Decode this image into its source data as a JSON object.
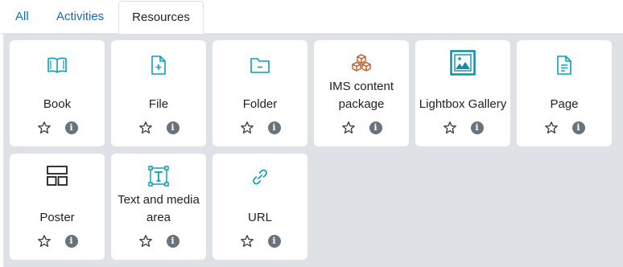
{
  "tabs": [
    {
      "label": "All",
      "active": false
    },
    {
      "label": "Activities",
      "active": false
    },
    {
      "label": "Resources",
      "active": true
    }
  ],
  "colors": {
    "teal": "#0d9eb7",
    "orange": "#c05a25",
    "dark": "#1d2125",
    "link": "#0f6cbf",
    "panel": "#dee2e6"
  },
  "modules": [
    {
      "label": "Book",
      "icon": "book-icon"
    },
    {
      "label": "File",
      "icon": "file-icon"
    },
    {
      "label": "Folder",
      "icon": "folder-icon"
    },
    {
      "label": "IMS content package",
      "icon": "ims-package-icon"
    },
    {
      "label": "Lightbox Gallery",
      "icon": "gallery-icon"
    },
    {
      "label": "Page",
      "icon": "page-icon"
    },
    {
      "label": "Poster",
      "icon": "poster-icon"
    },
    {
      "label": "Text and media area",
      "icon": "text-media-icon"
    },
    {
      "label": "URL",
      "icon": "url-icon"
    }
  ],
  "actions": {
    "star_icon": "star-outline-icon",
    "info_icon": "info-icon"
  }
}
